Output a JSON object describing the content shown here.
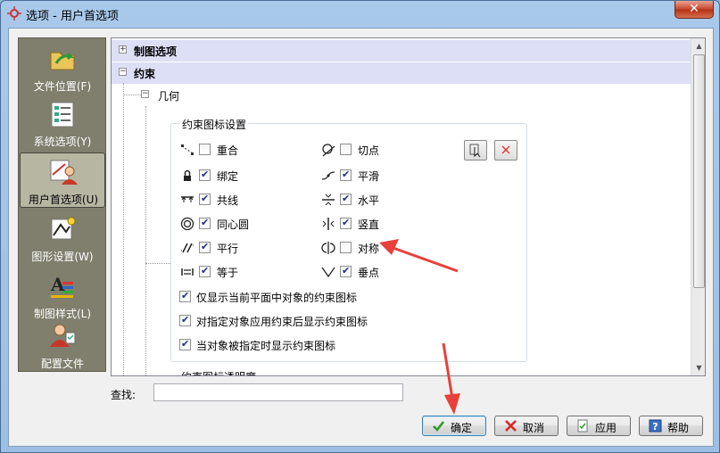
{
  "window": {
    "title": "选项 - 用户首选项",
    "close": "✕"
  },
  "sidebar": {
    "items": [
      {
        "label": "文件位置(F)"
      },
      {
        "label": "系统选项(Y)"
      },
      {
        "label": "用户首选项(U)"
      },
      {
        "label": "图形设置(W)"
      },
      {
        "label": "制图样式(L)"
      },
      {
        "label": "配置文件"
      }
    ]
  },
  "tree": {
    "expand_plus": "+",
    "expand_minus": "−",
    "node_drawing": "制图选项",
    "node_constraint": "约束",
    "node_geometry": "几何"
  },
  "group": {
    "title": "约束图标设置",
    "left": [
      {
        "label": "重合",
        "checked": false
      },
      {
        "label": "绑定",
        "checked": true
      },
      {
        "label": "共线",
        "checked": true
      },
      {
        "label": "同心圆",
        "checked": true
      },
      {
        "label": "平行",
        "checked": true
      },
      {
        "label": "等于",
        "checked": true
      }
    ],
    "right": [
      {
        "label": "切点",
        "checked": false
      },
      {
        "label": "平滑",
        "checked": true
      },
      {
        "label": "水平",
        "checked": true
      },
      {
        "label": "竖直",
        "checked": true
      },
      {
        "label": "对称",
        "checked": false
      },
      {
        "label": "垂点",
        "checked": true
      }
    ],
    "options": [
      {
        "label": "仅显示当前平面中对象的约束图标",
        "checked": true
      },
      {
        "label": "对指定对象应用约束后显示约束图标",
        "checked": true
      },
      {
        "label": "当对象被指定时显示约束图标",
        "checked": true
      }
    ]
  },
  "group2": {
    "title": "约束图标透明度"
  },
  "find": {
    "label": "查找:",
    "value": ""
  },
  "buttons": {
    "ok": "确定",
    "cancel": "取消",
    "apply": "应用",
    "help": "帮助"
  },
  "colors": {
    "arrow": "#e8403a",
    "highlight": "#dcdff5",
    "sidebar": "#807f6e"
  }
}
